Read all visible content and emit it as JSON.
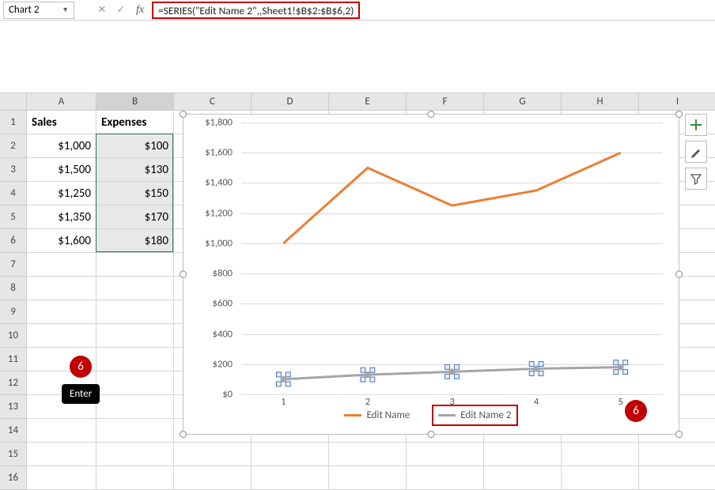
{
  "name_box": "Chart 2",
  "formula": "=SERIES(\"Edit Name 2\",,Sheet1!$B$2:$B$6,2)",
  "columns": [
    "A",
    "B",
    "C",
    "D",
    "E",
    "F",
    "G",
    "H",
    "I"
  ],
  "rows": [
    1,
    2,
    3,
    4,
    5,
    6,
    7,
    8,
    9,
    10,
    11,
    12,
    13,
    14,
    15,
    16
  ],
  "data": {
    "A1": "Sales",
    "B1": "Expenses",
    "A2": "$1,000",
    "B2": "$100",
    "A3": "$1,500",
    "B3": "$130",
    "A4": "$1,250",
    "B4": "$150",
    "A5": "$1,350",
    "B5": "$170",
    "A6": "$1,600",
    "B6": "$180"
  },
  "chart_data": {
    "type": "line",
    "categories": [
      1,
      2,
      3,
      4,
      5
    ],
    "series": [
      {
        "name": "Edit Name",
        "values": [
          1000,
          1500,
          1250,
          1350,
          1600
        ],
        "color": "#ed7d31"
      },
      {
        "name": "Edit Name 2",
        "values": [
          100,
          130,
          150,
          170,
          180
        ],
        "color": "#a5a5a5"
      }
    ],
    "ylim": [
      0,
      1800
    ],
    "ystep": 200,
    "y_ticks": [
      "$0",
      "$200",
      "$400",
      "$600",
      "$800",
      "$1,000",
      "$1,200",
      "$1,400",
      "$1,600",
      "$1,800"
    ],
    "x_ticks": [
      "1",
      "2",
      "3",
      "4",
      "5"
    ],
    "title": "",
    "xlabel": "",
    "ylabel": ""
  },
  "legend": {
    "s1": "Edit Name",
    "s2": "Edit Name 2"
  },
  "callouts": {
    "num": "6",
    "enter": "Enter"
  },
  "fb_icons": {
    "cancel": "✕",
    "confirm": "✓",
    "fx": "fx"
  },
  "tools": {
    "plus": "plus-icon",
    "brush": "brush-icon",
    "filter": "funnel-icon"
  }
}
